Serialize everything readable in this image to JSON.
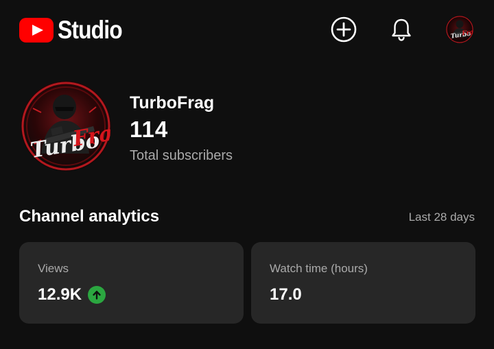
{
  "header": {
    "app_name": "Studio",
    "icons": {
      "logo": "youtube-logo-icon",
      "create": "plus-circle-icon",
      "notifications": "bell-icon",
      "account": "channel-avatar"
    }
  },
  "channel": {
    "name": "TurboFrag",
    "subscriber_count": "114",
    "subscriber_label": "Total subscribers",
    "avatar_logo_text": "TurboFrag"
  },
  "analytics": {
    "title": "Channel analytics",
    "period": "Last 28 days",
    "cards": [
      {
        "label": "Views",
        "value": "12.9K",
        "trend": "up",
        "trend_icon": "arrow-up-icon"
      },
      {
        "label": "Watch time (hours)",
        "value": "17.0"
      }
    ]
  },
  "colors": {
    "background": "#0f0f0f",
    "card": "#272727",
    "brand_red": "#ff0000",
    "trend_green": "#2ba640",
    "secondary_text": "#aaaaaa"
  }
}
